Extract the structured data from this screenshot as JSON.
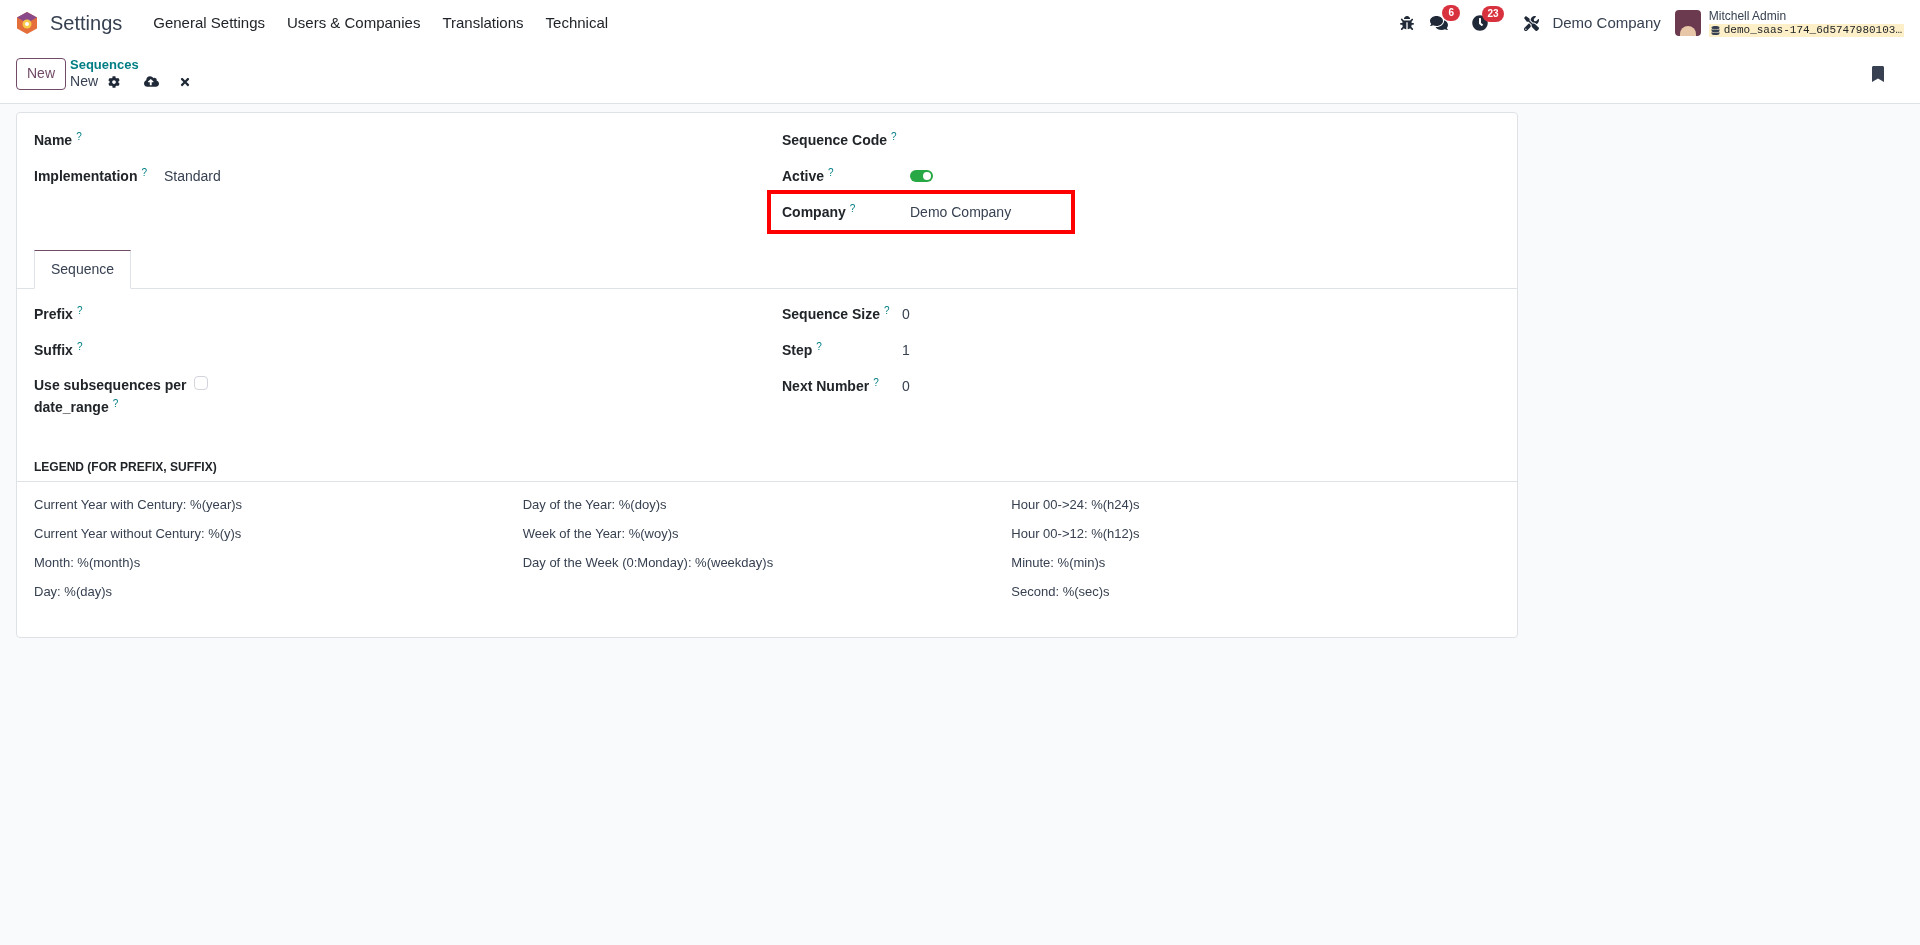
{
  "navbar": {
    "app_name": "Settings",
    "menu": [
      "General Settings",
      "Users & Companies",
      "Translations",
      "Technical"
    ],
    "messages_badge": "6",
    "activities_badge": "23",
    "company": "Demo Company",
    "user_name": "Mitchell Admin",
    "database": "demo_saas-174_6d5747980103…"
  },
  "control_panel": {
    "new_button": "New",
    "breadcrumb": "Sequences",
    "record": "New"
  },
  "form": {
    "left_fields": [
      {
        "label": "Name$^{?}$"
      },
      {
        "label": "Implementation$^{?}$",
        "value": "Standard"
      }
    ],
    "right_fields": [
      {
        "label": "Sequence Code$^{?}$",
        "kind": "text"
      },
      {
        "label": "Active$^{?}$",
        "kind": "toggle",
        "on": true
      },
      {
        "label": "Company$^{?}$",
        "kind": "text",
        "value": "Demo Company",
        "highlighted": true
      }
    ],
    "tabs": [
      {
        "label": "Sequence",
        "selected": true
      }
    ],
    "tab_left_fields": [
      {
        "label": "Prefix$^{?}$",
        "kind": "text"
      },
      {
        "label": "Suffix$^{?}$",
        "kind": "text"
      },
      {
        "label": "Use subsequences per date_range$^{?}$",
        "kind": "checkbox",
        "checked": false
      }
    ],
    "tab_right_fields": [
      {
        "label": "Sequence Size$^{?}$",
        "value": "0"
      },
      {
        "label": "Step$^{?}$",
        "value": "1"
      },
      {
        "label": "Next Number$^{?}$",
        "value": "0"
      }
    ],
    "legend_title": "LEGEND (FOR PREFIX, SUFFIX)",
    "legend_columns": [
      [
        "Current Year with Century: %(year)s",
        "Current Year without Century: %(y)s",
        "Month: %(month)s",
        "Day: %(day)s"
      ],
      [
        "Day of the Year: %(doy)s",
        "Week of the Year: %(woy)s",
        "Day of the Week (0:Monday): %(weekday)s"
      ],
      [
        "Hour 00->24: %(h24)s",
        "Hour 00->12: %(h12)s",
        "Minute: %(min)s",
        "Second: %(sec)s"
      ]
    ]
  }
}
